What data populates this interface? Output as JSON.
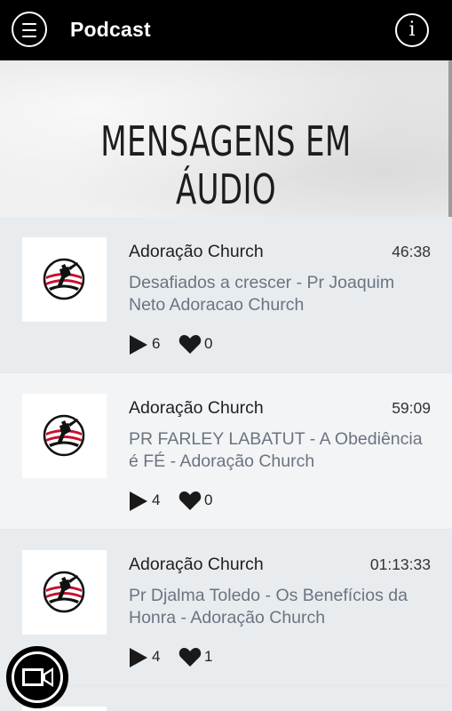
{
  "header": {
    "title": "Podcast",
    "menu_icon": "hamburger-menu-icon",
    "info_icon": "info-icon",
    "info_glyph": "i"
  },
  "hero": {
    "title": "MENSAGENS EM ÁUDIO"
  },
  "colors": {
    "header_bg": "#000000",
    "brand_red": "#c8102e",
    "message_text": "#6b7480"
  },
  "items": [
    {
      "author": "Adoração Church",
      "duration": "46:38",
      "message": "Desafiados a crescer - Pr Joaquim Neto Adoracao Church",
      "plays": "6",
      "likes": "0",
      "thumbnail_icon": "adoracao-church-logo"
    },
    {
      "author": "Adoração Church",
      "duration": "59:09",
      "message": "PR FARLEY LABATUT - A Obediência é FÉ - Adoração Church",
      "plays": "4",
      "likes": "0",
      "thumbnail_icon": "adoracao-church-logo"
    },
    {
      "author": "Adoração Church",
      "duration": "01:13:33",
      "message": "Pr Djalma Toledo - Os Benefícios da Honra - Adoração Church",
      "plays": "4",
      "likes": "1",
      "thumbnail_icon": "adoracao-church-logo"
    }
  ],
  "fab": {
    "icon": "video-camera-icon"
  }
}
